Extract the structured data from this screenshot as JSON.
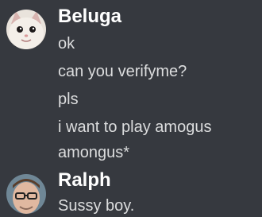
{
  "messages": [
    {
      "author": "Beluga",
      "lines": [
        "ok",
        "can you verifyme?",
        "pls",
        "i want to play amogus",
        "amongus*"
      ]
    },
    {
      "author": "Ralph",
      "lines": [
        "Sussy boy."
      ]
    }
  ]
}
